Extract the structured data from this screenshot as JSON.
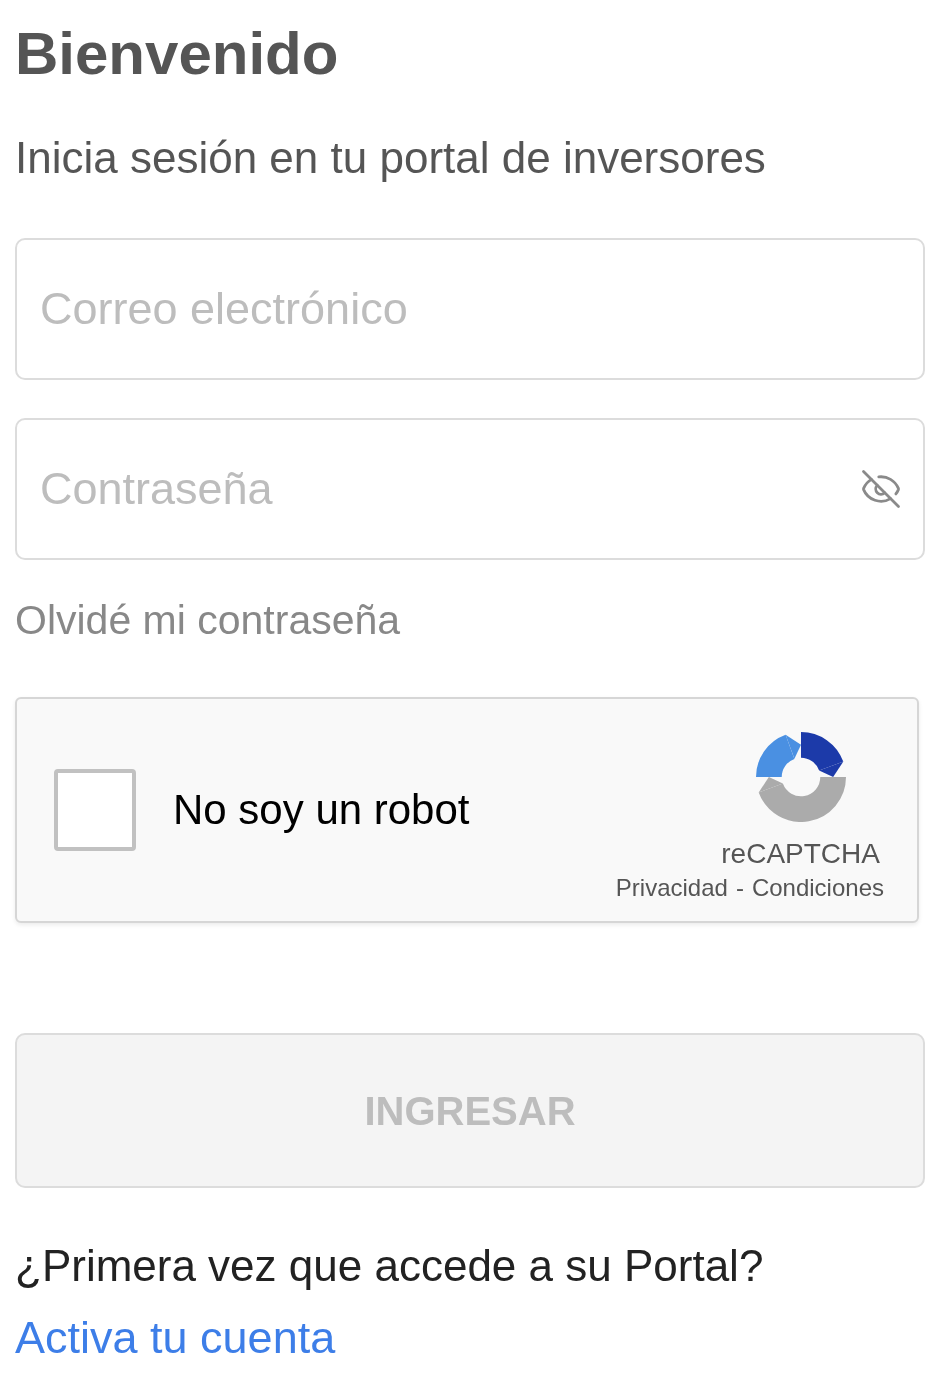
{
  "header": {
    "title": "Bienvenido",
    "subtitle": "Inicia sesión en tu portal de inversores"
  },
  "form": {
    "fields": [
      {
        "kind": "email",
        "placeholder": "Correo electrónico"
      },
      {
        "kind": "password",
        "placeholder": "Contraseña",
        "password_visible": false
      }
    ],
    "forgot_link": "Olvidé mi contraseña",
    "captcha": {
      "checked": false,
      "label": "No soy un robot",
      "brand": "reCAPTCHA",
      "links": [
        "Privacidad",
        "Condiciones"
      ],
      "separator": "-"
    },
    "submit": {
      "label": "INGRESAR",
      "disabled": true
    }
  },
  "footer": {
    "question": "¿Primera vez que accede a su Portal?",
    "link": "Activa tu cuenta"
  }
}
